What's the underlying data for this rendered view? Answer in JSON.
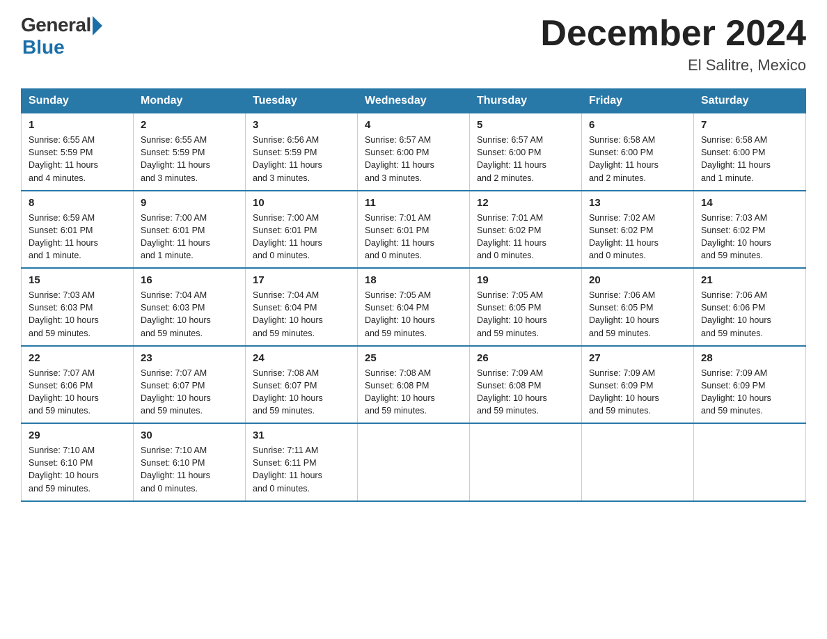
{
  "logo": {
    "general": "General",
    "blue": "Blue",
    "subtitle": "Blue"
  },
  "title": "December 2024",
  "location": "El Salitre, Mexico",
  "days_of_week": [
    "Sunday",
    "Monday",
    "Tuesday",
    "Wednesday",
    "Thursday",
    "Friday",
    "Saturday"
  ],
  "weeks": [
    [
      {
        "day": "1",
        "info": "Sunrise: 6:55 AM\nSunset: 5:59 PM\nDaylight: 11 hours\nand 4 minutes."
      },
      {
        "day": "2",
        "info": "Sunrise: 6:55 AM\nSunset: 5:59 PM\nDaylight: 11 hours\nand 3 minutes."
      },
      {
        "day": "3",
        "info": "Sunrise: 6:56 AM\nSunset: 5:59 PM\nDaylight: 11 hours\nand 3 minutes."
      },
      {
        "day": "4",
        "info": "Sunrise: 6:57 AM\nSunset: 6:00 PM\nDaylight: 11 hours\nand 3 minutes."
      },
      {
        "day": "5",
        "info": "Sunrise: 6:57 AM\nSunset: 6:00 PM\nDaylight: 11 hours\nand 2 minutes."
      },
      {
        "day": "6",
        "info": "Sunrise: 6:58 AM\nSunset: 6:00 PM\nDaylight: 11 hours\nand 2 minutes."
      },
      {
        "day": "7",
        "info": "Sunrise: 6:58 AM\nSunset: 6:00 PM\nDaylight: 11 hours\nand 1 minute."
      }
    ],
    [
      {
        "day": "8",
        "info": "Sunrise: 6:59 AM\nSunset: 6:01 PM\nDaylight: 11 hours\nand 1 minute."
      },
      {
        "day": "9",
        "info": "Sunrise: 7:00 AM\nSunset: 6:01 PM\nDaylight: 11 hours\nand 1 minute."
      },
      {
        "day": "10",
        "info": "Sunrise: 7:00 AM\nSunset: 6:01 PM\nDaylight: 11 hours\nand 0 minutes."
      },
      {
        "day": "11",
        "info": "Sunrise: 7:01 AM\nSunset: 6:01 PM\nDaylight: 11 hours\nand 0 minutes."
      },
      {
        "day": "12",
        "info": "Sunrise: 7:01 AM\nSunset: 6:02 PM\nDaylight: 11 hours\nand 0 minutes."
      },
      {
        "day": "13",
        "info": "Sunrise: 7:02 AM\nSunset: 6:02 PM\nDaylight: 11 hours\nand 0 minutes."
      },
      {
        "day": "14",
        "info": "Sunrise: 7:03 AM\nSunset: 6:02 PM\nDaylight: 10 hours\nand 59 minutes."
      }
    ],
    [
      {
        "day": "15",
        "info": "Sunrise: 7:03 AM\nSunset: 6:03 PM\nDaylight: 10 hours\nand 59 minutes."
      },
      {
        "day": "16",
        "info": "Sunrise: 7:04 AM\nSunset: 6:03 PM\nDaylight: 10 hours\nand 59 minutes."
      },
      {
        "day": "17",
        "info": "Sunrise: 7:04 AM\nSunset: 6:04 PM\nDaylight: 10 hours\nand 59 minutes."
      },
      {
        "day": "18",
        "info": "Sunrise: 7:05 AM\nSunset: 6:04 PM\nDaylight: 10 hours\nand 59 minutes."
      },
      {
        "day": "19",
        "info": "Sunrise: 7:05 AM\nSunset: 6:05 PM\nDaylight: 10 hours\nand 59 minutes."
      },
      {
        "day": "20",
        "info": "Sunrise: 7:06 AM\nSunset: 6:05 PM\nDaylight: 10 hours\nand 59 minutes."
      },
      {
        "day": "21",
        "info": "Sunrise: 7:06 AM\nSunset: 6:06 PM\nDaylight: 10 hours\nand 59 minutes."
      }
    ],
    [
      {
        "day": "22",
        "info": "Sunrise: 7:07 AM\nSunset: 6:06 PM\nDaylight: 10 hours\nand 59 minutes."
      },
      {
        "day": "23",
        "info": "Sunrise: 7:07 AM\nSunset: 6:07 PM\nDaylight: 10 hours\nand 59 minutes."
      },
      {
        "day": "24",
        "info": "Sunrise: 7:08 AM\nSunset: 6:07 PM\nDaylight: 10 hours\nand 59 minutes."
      },
      {
        "day": "25",
        "info": "Sunrise: 7:08 AM\nSunset: 6:08 PM\nDaylight: 10 hours\nand 59 minutes."
      },
      {
        "day": "26",
        "info": "Sunrise: 7:09 AM\nSunset: 6:08 PM\nDaylight: 10 hours\nand 59 minutes."
      },
      {
        "day": "27",
        "info": "Sunrise: 7:09 AM\nSunset: 6:09 PM\nDaylight: 10 hours\nand 59 minutes."
      },
      {
        "day": "28",
        "info": "Sunrise: 7:09 AM\nSunset: 6:09 PM\nDaylight: 10 hours\nand 59 minutes."
      }
    ],
    [
      {
        "day": "29",
        "info": "Sunrise: 7:10 AM\nSunset: 6:10 PM\nDaylight: 10 hours\nand 59 minutes."
      },
      {
        "day": "30",
        "info": "Sunrise: 7:10 AM\nSunset: 6:10 PM\nDaylight: 11 hours\nand 0 minutes."
      },
      {
        "day": "31",
        "info": "Sunrise: 7:11 AM\nSunset: 6:11 PM\nDaylight: 11 hours\nand 0 minutes."
      },
      {
        "day": "",
        "info": ""
      },
      {
        "day": "",
        "info": ""
      },
      {
        "day": "",
        "info": ""
      },
      {
        "day": "",
        "info": ""
      }
    ]
  ]
}
